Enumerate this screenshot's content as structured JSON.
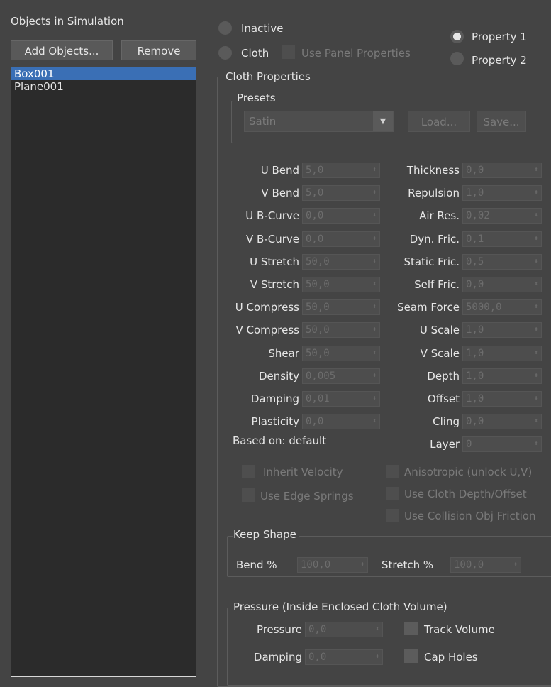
{
  "objects_panel": {
    "title": "Objects in Simulation",
    "add_label": "Add Objects...",
    "remove_label": "Remove",
    "items": [
      "Box001",
      "Plane001"
    ]
  },
  "mode": {
    "inactive": "Inactive",
    "cloth": "Cloth",
    "use_panel": "Use Panel Properties",
    "property1": "Property 1",
    "property2": "Property 2"
  },
  "cloth": {
    "title": "Cloth Properties",
    "presets_title": "Presets",
    "preset_value": "Satin",
    "load_label": "Load...",
    "save_label": "Save...",
    "left": [
      {
        "label": "U Bend",
        "value": "5,0"
      },
      {
        "label": "V Bend",
        "value": "5,0"
      },
      {
        "label": "U B-Curve",
        "value": "0,0"
      },
      {
        "label": "V B-Curve",
        "value": "0,0"
      },
      {
        "label": "U Stretch",
        "value": "50,0"
      },
      {
        "label": "V Stretch",
        "value": "50,0"
      },
      {
        "label": "U Compress",
        "value": "50,0"
      },
      {
        "label": "V Compress",
        "value": "50,0"
      },
      {
        "label": "Shear",
        "value": "50,0"
      },
      {
        "label": "Density",
        "value": "0,005"
      },
      {
        "label": "Damping",
        "value": "0,01"
      },
      {
        "label": "Plasticity",
        "value": "0,0"
      }
    ],
    "right": [
      {
        "label": "Thickness",
        "value": "0,0"
      },
      {
        "label": "Repulsion",
        "value": "1,0"
      },
      {
        "label": "Air Res.",
        "value": "0,02"
      },
      {
        "label": "Dyn. Fric.",
        "value": "0,1"
      },
      {
        "label": "Static Fric.",
        "value": "0,5"
      },
      {
        "label": "Self Fric.",
        "value": "0,0"
      },
      {
        "label": "Seam Force",
        "value": "5000,0"
      },
      {
        "label": "U Scale",
        "value": "1,0"
      },
      {
        "label": "V Scale",
        "value": "1,0"
      },
      {
        "label": "Depth",
        "value": "1,0"
      },
      {
        "label": "Offset",
        "value": "1,0"
      },
      {
        "label": "Cling",
        "value": "0,0"
      },
      {
        "label": "Layer",
        "value": "0"
      }
    ],
    "based_on": "Based on: default",
    "checks": {
      "inherit": "Inherit Velocity",
      "edge": "Use Edge Springs",
      "aniso": "Anisotropic (unlock U,V)",
      "depth": "Use Cloth Depth/Offset",
      "collision": "Use Collision Obj Friction"
    }
  },
  "keep_shape": {
    "title": "Keep Shape",
    "bend_label": "Bend %",
    "bend_value": "100,0",
    "stretch_label": "Stretch %",
    "stretch_value": "100,0"
  },
  "pressure": {
    "title": "Pressure (Inside Enclosed Cloth Volume)",
    "pressure_label": "Pressure",
    "pressure_value": "0,0",
    "damping_label": "Damping",
    "damping_value": "0,0",
    "track": "Track Volume",
    "cap": "Cap Holes"
  },
  "icons": {
    "spinner": "spinner-arrows-icon",
    "dropdown": "dropdown-arrow-icon"
  }
}
